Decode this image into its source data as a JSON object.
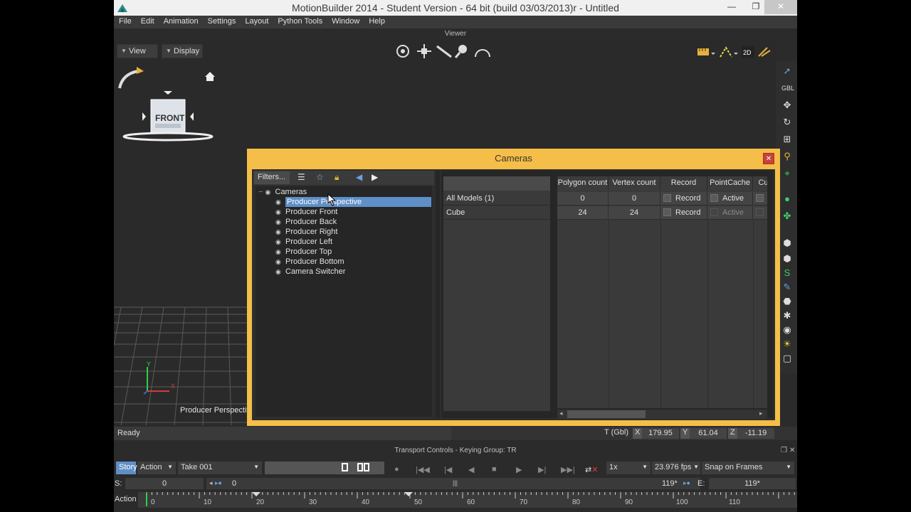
{
  "window": {
    "title": "MotionBuilder 2014 - Student Version    - 64 bit (build 03/03/2013)r  - Untitled",
    "minimize": "—",
    "maximize": "❐",
    "close": "✕"
  },
  "menu": [
    "File",
    "Edit",
    "Animation",
    "Settings",
    "Layout",
    "Python Tools",
    "Window",
    "Help"
  ],
  "viewer": {
    "label": "Viewer",
    "view_btn": "View",
    "display_btn": "Display",
    "front_label": "FRONT",
    "camera_label": "Producer Perspective",
    "axis_y": "Y",
    "axis_x": "X",
    "toolbar_2d": "2D",
    "right_gbl": "GBL"
  },
  "cameras_dialog": {
    "title": "Cameras",
    "filters_label": "Filters...",
    "tree_root": "Cameras",
    "tree_items": [
      "Producer Perspective",
      "Producer Front",
      "Producer Back",
      "Producer Right",
      "Producer Left",
      "Producer Top",
      "Producer Bottom",
      "Camera Switcher"
    ],
    "selected_index": 0,
    "row_headers": [
      "All Models (1)",
      "Cube"
    ],
    "columns": [
      "Polygon count",
      "Vertex count",
      "Record",
      "PointCache",
      "Cu"
    ],
    "rows": [
      {
        "polygon": "0",
        "vertex": "0",
        "record": "Record",
        "pointcache": "Active",
        "pointcache_dim": false
      },
      {
        "polygon": "24",
        "vertex": "24",
        "record": "Record",
        "pointcache": "Active",
        "pointcache_dim": true
      }
    ]
  },
  "status": {
    "ready": "Ready",
    "t_label": "T (Gbl)",
    "x_label": "X",
    "x_value": "179.95",
    "y_label": "Y",
    "y_value": "61.04",
    "z_label": "Z",
    "z_value": "-11.19"
  },
  "transport": {
    "label": "Transport Controls  -  Keying Group: TR",
    "story": "Story",
    "action": "Action",
    "take": "Take 001",
    "speed": "1x",
    "fps": "23.976 fps",
    "snap": "Snap on Frames",
    "s_label": "S:",
    "s_value": "0",
    "current": "0",
    "end_marker": "119*",
    "e_label": "E:",
    "e_value": "119*",
    "action_label": "Action",
    "ruler_ticks": [
      "0",
      "10",
      "20",
      "30",
      "40",
      "50",
      "60",
      "70",
      "80",
      "90",
      "100",
      "110"
    ]
  }
}
